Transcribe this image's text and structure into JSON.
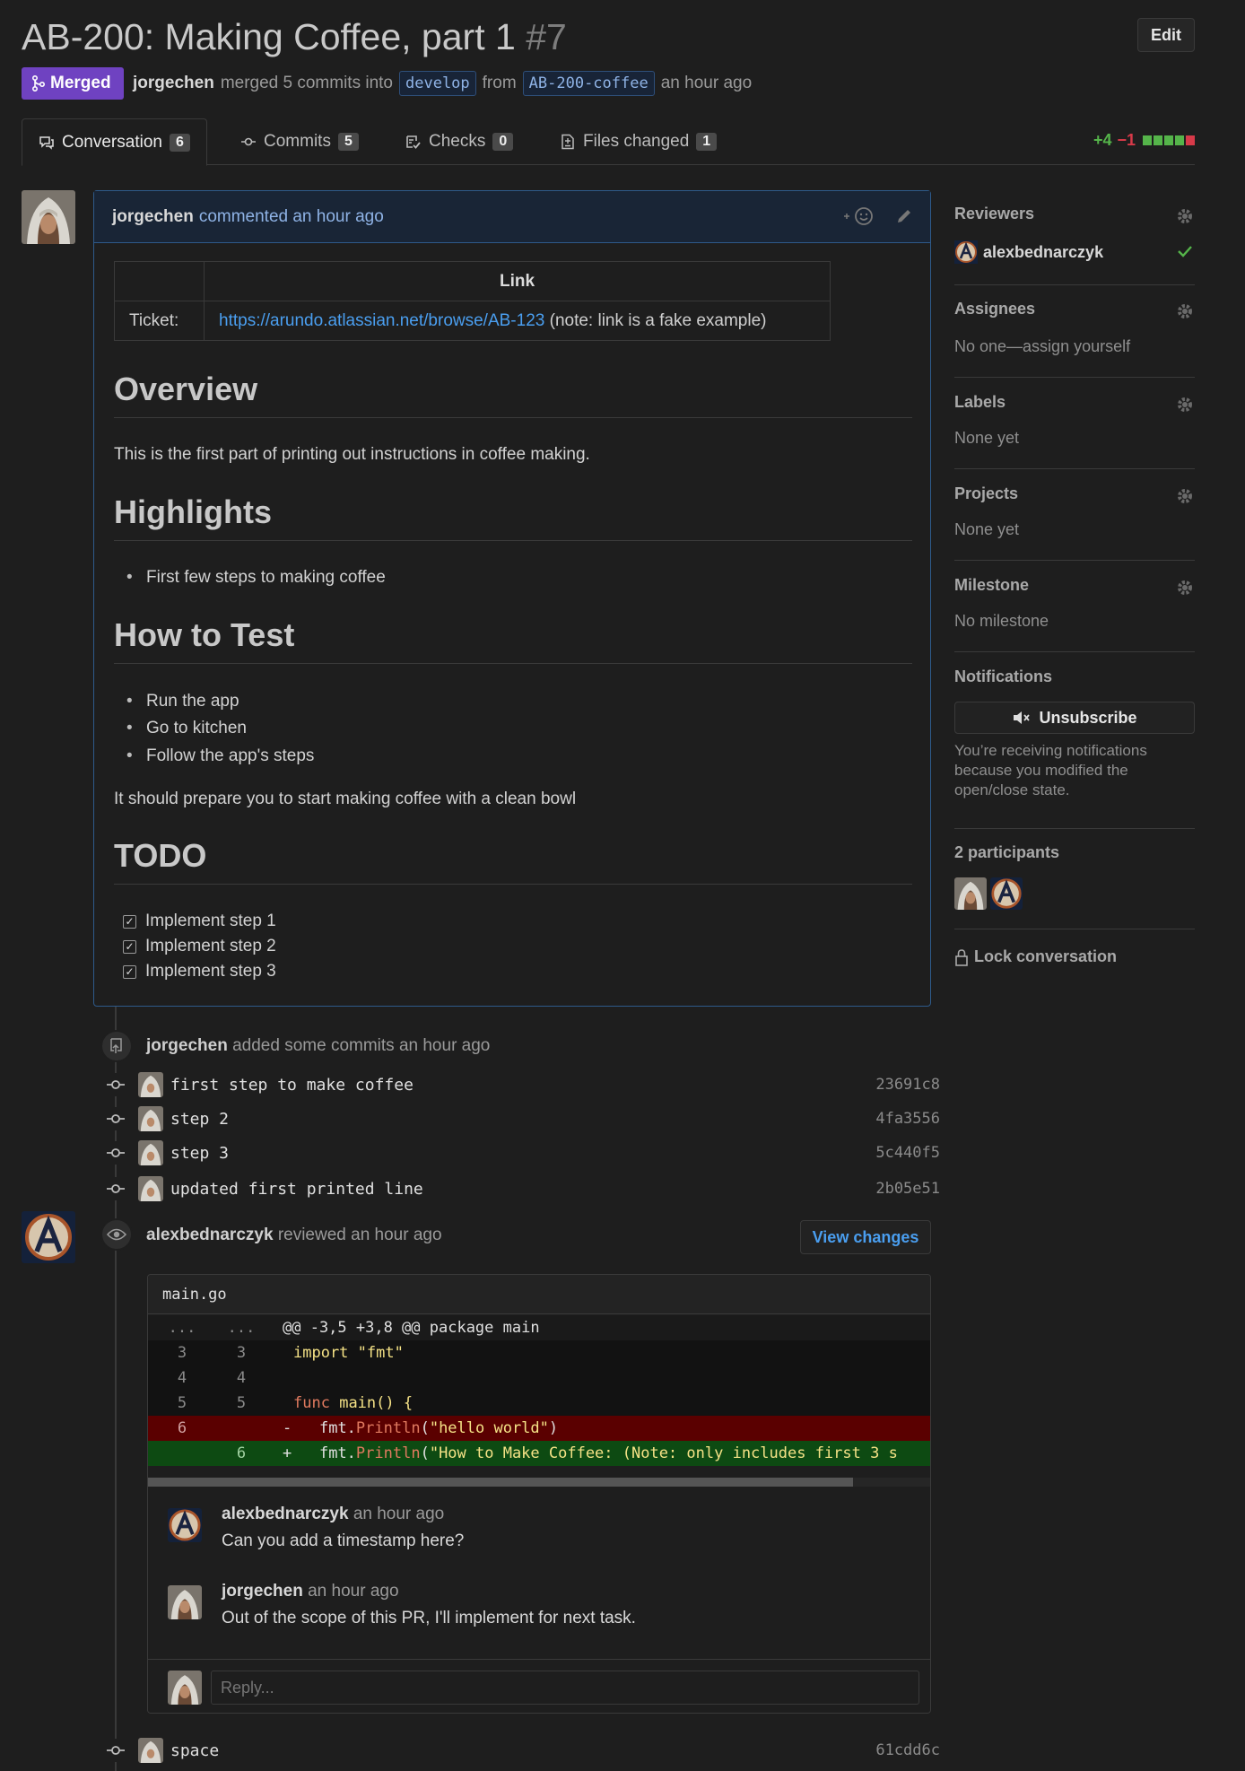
{
  "header": {
    "title": "AB-200: Making Coffee, part 1",
    "number": "#7",
    "edit_label": "Edit",
    "state_label": "Merged",
    "author": "jorgechen",
    "merged_text": "merged 5 commits into",
    "base_branch": "develop",
    "from_text": "from",
    "head_branch": "AB-200-coffee",
    "time": "an hour ago"
  },
  "tabs": [
    {
      "label": "Conversation",
      "count": "6",
      "icon": "comment-discussion-icon"
    },
    {
      "label": "Commits",
      "count": "5",
      "icon": "git-commit-icon"
    },
    {
      "label": "Checks",
      "count": "0",
      "icon": "checklist-icon"
    },
    {
      "label": "Files changed",
      "count": "1",
      "icon": "file-diff-icon"
    }
  ],
  "diffstat": {
    "additions": "+4",
    "deletions": "−1"
  },
  "main_comment": {
    "author": "jorgechen",
    "meta": "commented an hour ago",
    "table": {
      "header": "Link",
      "row_label": "Ticket:",
      "link": "https://arundo.atlassian.net/browse/AB-123",
      "note": "(note: link is a fake example)"
    },
    "overview_heading": "Overview",
    "overview_text": "This is the first part of printing out instructions in coffee making.",
    "highlights_heading": "Highlights",
    "highlights": [
      "First few steps to making coffee"
    ],
    "howto_heading": "How to Test",
    "howto": [
      "Run the app",
      "Go to kitchen",
      "Follow the app's steps"
    ],
    "howto_text": "It should prepare you to start making coffee with a clean bowl",
    "todo_heading": "TODO",
    "todo": [
      "Implement step 1",
      "Implement step 2",
      "Implement step 3"
    ]
  },
  "sidebar": {
    "reviewers_title": "Reviewers",
    "reviewer": "alexbednarczyk",
    "assignees_title": "Assignees",
    "assignees_value": "No one—assign yourself",
    "labels_title": "Labels",
    "labels_value": "None yet",
    "projects_title": "Projects",
    "projects_value": "None yet",
    "milestone_title": "Milestone",
    "milestone_value": "No milestone",
    "notifications_title": "Notifications",
    "unsubscribe_label": "Unsubscribe",
    "notifications_text_1": "You’re receiving notifications",
    "notifications_text_2": "because you modified the",
    "notifications_text_3": "open/close state.",
    "participants_title": "2 participants",
    "lock_label": "Lock conversation"
  },
  "timeline": {
    "commits_event": {
      "user": "jorgechen",
      "text": "added some commits",
      "time": "an hour ago"
    },
    "commits": [
      {
        "message": "first step to make coffee",
        "sha": "23691c8"
      },
      {
        "message": "step 2",
        "sha": "4fa3556"
      },
      {
        "message": "step 3",
        "sha": "5c440f5"
      },
      {
        "message": "updated first printed line",
        "sha": "2b05e51"
      }
    ],
    "review_event": {
      "user": "alexbednarczyk",
      "text": "reviewed",
      "time": "an hour ago",
      "view_changes_label": "View changes"
    },
    "review": {
      "file": "main.go",
      "hunk": {
        "old": "...",
        "new": "...",
        "header": "@@ -3,5 +3,8 @@ package main"
      },
      "lines": [
        {
          "old": "3",
          "new": "3",
          "type": "ctx"
        },
        {
          "old": "4",
          "new": "4",
          "type": "ctx"
        },
        {
          "old": "5",
          "new": "5",
          "type": "ctx"
        },
        {
          "old": "6",
          "new": "",
          "type": "del"
        },
        {
          "old": "",
          "new": "6",
          "type": "add"
        }
      ],
      "code": {
        "import_kw": "import",
        "import_str": "\"fmt\"",
        "func_kw": "func",
        "func_name": "main() {",
        "del_sign": "-",
        "add_sign": "+",
        "fmt_pkg": "fmt.",
        "println": "Println",
        "del_open": "(",
        "del_str": "\"hello world\"",
        "del_close": ")",
        "add_open": "(",
        "add_str": "\"How to Make Coffee: (Note: only includes first 3 s"
      },
      "comments": [
        {
          "user": "alexbednarczyk",
          "time": "an hour ago",
          "body": "Can you add a timestamp here?"
        },
        {
          "user": "jorgechen",
          "time": "an hour ago",
          "body": "Out of the scope of this PR, I'll implement for next task."
        }
      ],
      "reply_placeholder": "Reply..."
    },
    "last_commit": {
      "message": "space",
      "sha": "61cdd6c"
    }
  },
  "colors": {
    "merged": "#6f42c1",
    "link": "#4a9eef",
    "addition": "#55b44a",
    "deletion": "#d73a49",
    "del_row_bg": "#5a0000",
    "add_row_bg": "#0d4a12"
  }
}
